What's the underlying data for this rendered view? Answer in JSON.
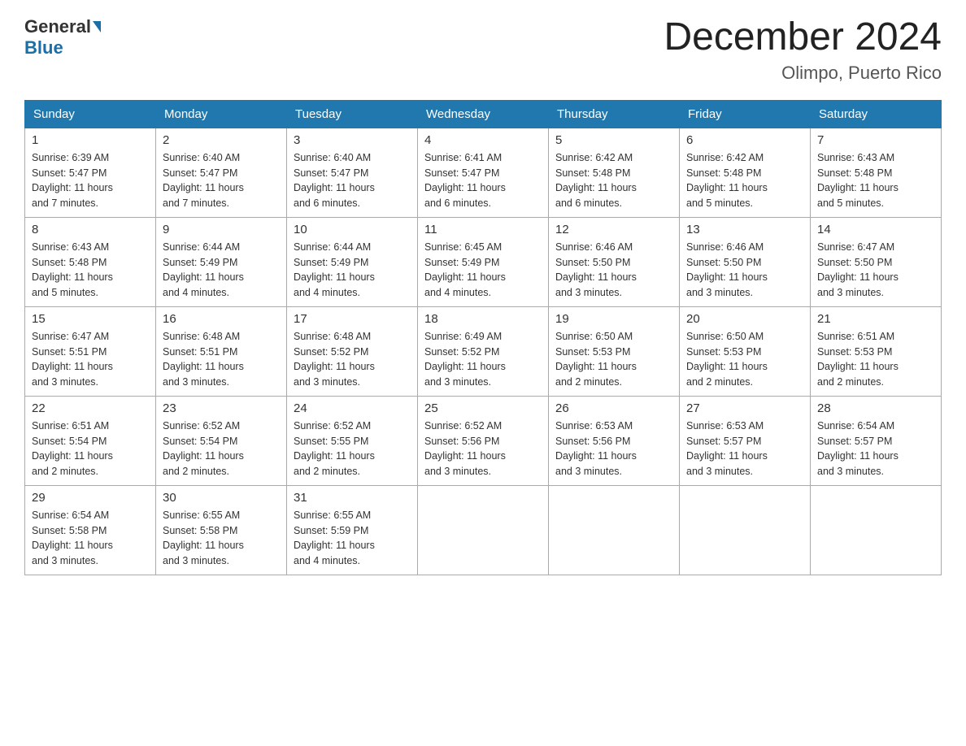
{
  "header": {
    "logo_general": "General",
    "logo_blue": "Blue",
    "month_title": "December 2024",
    "location": "Olimpo, Puerto Rico"
  },
  "days_of_week": [
    "Sunday",
    "Monday",
    "Tuesday",
    "Wednesday",
    "Thursday",
    "Friday",
    "Saturday"
  ],
  "weeks": [
    [
      {
        "num": "1",
        "sunrise": "6:39 AM",
        "sunset": "5:47 PM",
        "daylight": "11 hours and 7 minutes."
      },
      {
        "num": "2",
        "sunrise": "6:40 AM",
        "sunset": "5:47 PM",
        "daylight": "11 hours and 7 minutes."
      },
      {
        "num": "3",
        "sunrise": "6:40 AM",
        "sunset": "5:47 PM",
        "daylight": "11 hours and 6 minutes."
      },
      {
        "num": "4",
        "sunrise": "6:41 AM",
        "sunset": "5:47 PM",
        "daylight": "11 hours and 6 minutes."
      },
      {
        "num": "5",
        "sunrise": "6:42 AM",
        "sunset": "5:48 PM",
        "daylight": "11 hours and 6 minutes."
      },
      {
        "num": "6",
        "sunrise": "6:42 AM",
        "sunset": "5:48 PM",
        "daylight": "11 hours and 5 minutes."
      },
      {
        "num": "7",
        "sunrise": "6:43 AM",
        "sunset": "5:48 PM",
        "daylight": "11 hours and 5 minutes."
      }
    ],
    [
      {
        "num": "8",
        "sunrise": "6:43 AM",
        "sunset": "5:48 PM",
        "daylight": "11 hours and 5 minutes."
      },
      {
        "num": "9",
        "sunrise": "6:44 AM",
        "sunset": "5:49 PM",
        "daylight": "11 hours and 4 minutes."
      },
      {
        "num": "10",
        "sunrise": "6:44 AM",
        "sunset": "5:49 PM",
        "daylight": "11 hours and 4 minutes."
      },
      {
        "num": "11",
        "sunrise": "6:45 AM",
        "sunset": "5:49 PM",
        "daylight": "11 hours and 4 minutes."
      },
      {
        "num": "12",
        "sunrise": "6:46 AM",
        "sunset": "5:50 PM",
        "daylight": "11 hours and 3 minutes."
      },
      {
        "num": "13",
        "sunrise": "6:46 AM",
        "sunset": "5:50 PM",
        "daylight": "11 hours and 3 minutes."
      },
      {
        "num": "14",
        "sunrise": "6:47 AM",
        "sunset": "5:50 PM",
        "daylight": "11 hours and 3 minutes."
      }
    ],
    [
      {
        "num": "15",
        "sunrise": "6:47 AM",
        "sunset": "5:51 PM",
        "daylight": "11 hours and 3 minutes."
      },
      {
        "num": "16",
        "sunrise": "6:48 AM",
        "sunset": "5:51 PM",
        "daylight": "11 hours and 3 minutes."
      },
      {
        "num": "17",
        "sunrise": "6:48 AM",
        "sunset": "5:52 PM",
        "daylight": "11 hours and 3 minutes."
      },
      {
        "num": "18",
        "sunrise": "6:49 AM",
        "sunset": "5:52 PM",
        "daylight": "11 hours and 3 minutes."
      },
      {
        "num": "19",
        "sunrise": "6:50 AM",
        "sunset": "5:53 PM",
        "daylight": "11 hours and 2 minutes."
      },
      {
        "num": "20",
        "sunrise": "6:50 AM",
        "sunset": "5:53 PM",
        "daylight": "11 hours and 2 minutes."
      },
      {
        "num": "21",
        "sunrise": "6:51 AM",
        "sunset": "5:53 PM",
        "daylight": "11 hours and 2 minutes."
      }
    ],
    [
      {
        "num": "22",
        "sunrise": "6:51 AM",
        "sunset": "5:54 PM",
        "daylight": "11 hours and 2 minutes."
      },
      {
        "num": "23",
        "sunrise": "6:52 AM",
        "sunset": "5:54 PM",
        "daylight": "11 hours and 2 minutes."
      },
      {
        "num": "24",
        "sunrise": "6:52 AM",
        "sunset": "5:55 PM",
        "daylight": "11 hours and 2 minutes."
      },
      {
        "num": "25",
        "sunrise": "6:52 AM",
        "sunset": "5:56 PM",
        "daylight": "11 hours and 3 minutes."
      },
      {
        "num": "26",
        "sunrise": "6:53 AM",
        "sunset": "5:56 PM",
        "daylight": "11 hours and 3 minutes."
      },
      {
        "num": "27",
        "sunrise": "6:53 AM",
        "sunset": "5:57 PM",
        "daylight": "11 hours and 3 minutes."
      },
      {
        "num": "28",
        "sunrise": "6:54 AM",
        "sunset": "5:57 PM",
        "daylight": "11 hours and 3 minutes."
      }
    ],
    [
      {
        "num": "29",
        "sunrise": "6:54 AM",
        "sunset": "5:58 PM",
        "daylight": "11 hours and 3 minutes."
      },
      {
        "num": "30",
        "sunrise": "6:55 AM",
        "sunset": "5:58 PM",
        "daylight": "11 hours and 3 minutes."
      },
      {
        "num": "31",
        "sunrise": "6:55 AM",
        "sunset": "5:59 PM",
        "daylight": "11 hours and 4 minutes."
      },
      null,
      null,
      null,
      null
    ]
  ],
  "labels": {
    "sunrise": "Sunrise:",
    "sunset": "Sunset:",
    "daylight": "Daylight:"
  }
}
